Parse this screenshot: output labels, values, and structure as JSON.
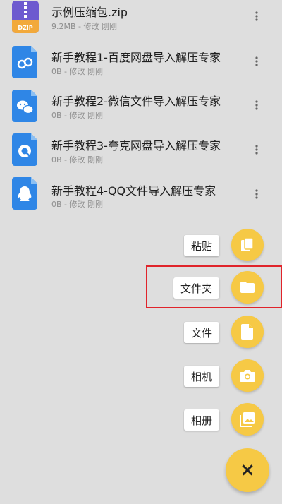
{
  "colors": {
    "accent": "#f6c945",
    "background": "#dedede",
    "highlight": "#e0242b",
    "zip_icon_purple": "#6d5acf",
    "zip_icon_orange": "#f2a93b",
    "doc_icon_blue": "#2f86e6"
  },
  "files": [
    {
      "icon": "zip-archive-icon",
      "badge": "DZIP",
      "name": "示例压缩包.zip",
      "meta": "9.2MB - 修改 刚刚"
    },
    {
      "icon": "baidu-doc-icon",
      "name": "新手教程1-百度网盘导入解压专家",
      "meta": "0B - 修改 刚刚"
    },
    {
      "icon": "wechat-doc-icon",
      "name": "新手教程2-微信文件导入解压专家",
      "meta": "0B - 修改 刚刚"
    },
    {
      "icon": "quark-doc-icon",
      "name": "新手教程3-夸克网盘导入解压专家",
      "meta": "0B - 修改 刚刚"
    },
    {
      "icon": "qq-doc-icon",
      "name": "新手教程4-QQ文件导入解压专家",
      "meta": "0B - 修改 刚刚"
    }
  ],
  "fab_menu": [
    {
      "label": "粘贴",
      "icon": "paste-icon"
    },
    {
      "label": "文件夹",
      "icon": "folder-icon"
    },
    {
      "label": "文件",
      "icon": "file-icon"
    },
    {
      "label": "相机",
      "icon": "camera-icon"
    },
    {
      "label": "相册",
      "icon": "gallery-icon"
    }
  ],
  "fab_main": {
    "icon": "close-icon",
    "glyph": "×"
  }
}
